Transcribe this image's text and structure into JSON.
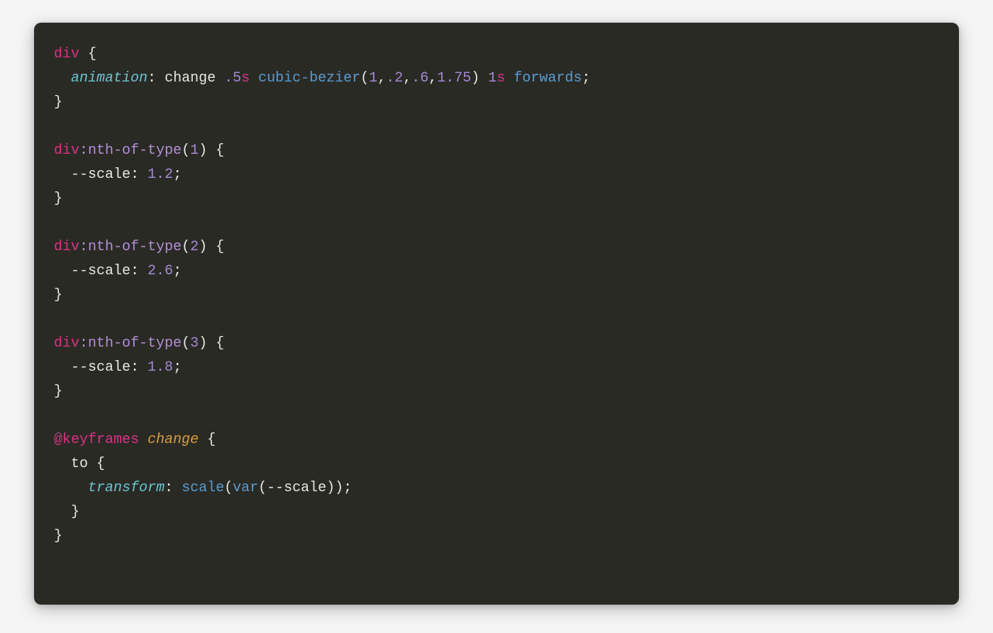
{
  "code": {
    "r1_sel": "div",
    "r1_brace": " {",
    "r2_pad": "  ",
    "r2_prop": "animation",
    "r2_colon": ": ",
    "r2_v1": "change ",
    "r2_n1": ".5",
    "r2_u1": "s",
    "r2_sp1": " ",
    "r2_fn": "cubic-bezier",
    "r2_p1": "(",
    "r2_a1": "1",
    "r2_c1": ",",
    "r2_a2": ".2",
    "r2_c2": ",",
    "r2_a3": ".6",
    "r2_c3": ",",
    "r2_a4": "1.75",
    "r2_p2": ") ",
    "r2_n2": "1",
    "r2_u2": "s",
    "r2_sp2": " ",
    "r2_v2": "forwards",
    "r2_semi": ";",
    "r3_close": "}",
    "r5_sel": "div",
    "r5_ps": ":nth-of-type",
    "r5_p1": "(",
    "r5_arg": "1",
    "r5_p2": ")",
    "r5_brace": " {",
    "r6_pad": "  ",
    "r6_prop": "--scale",
    "r6_colon": ": ",
    "r6_val": "1.2",
    "r6_semi": ";",
    "r7_close": "}",
    "r9_sel": "div",
    "r9_ps": ":nth-of-type",
    "r9_p1": "(",
    "r9_arg": "2",
    "r9_p2": ")",
    "r9_brace": " {",
    "r10_pad": "  ",
    "r10_prop": "--scale",
    "r10_colon": ": ",
    "r10_val": "2.6",
    "r10_semi": ";",
    "r11_close": "}",
    "r13_sel": "div",
    "r13_ps": ":nth-of-type",
    "r13_p1": "(",
    "r13_arg": "3",
    "r13_p2": ")",
    "r13_brace": " {",
    "r14_pad": "  ",
    "r14_prop": "--scale",
    "r14_colon": ": ",
    "r14_val": "1.8",
    "r14_semi": ";",
    "r15_close": "}",
    "r17_at": "@keyframes",
    "r17_sp": " ",
    "r17_name": "change",
    "r17_brace": " {",
    "r18_pad": "  ",
    "r18_to": "to",
    "r18_brace": " {",
    "r19_pad": "    ",
    "r19_prop": "transform",
    "r19_colon": ": ",
    "r19_fn1": "scale",
    "r19_p1": "(",
    "r19_fn2": "var",
    "r19_p2": "(",
    "r19_var": "--scale",
    "r19_p3": "))",
    "r19_semi": ";",
    "r20_pad": "  ",
    "r20_close": "}",
    "r21_close": "}"
  }
}
